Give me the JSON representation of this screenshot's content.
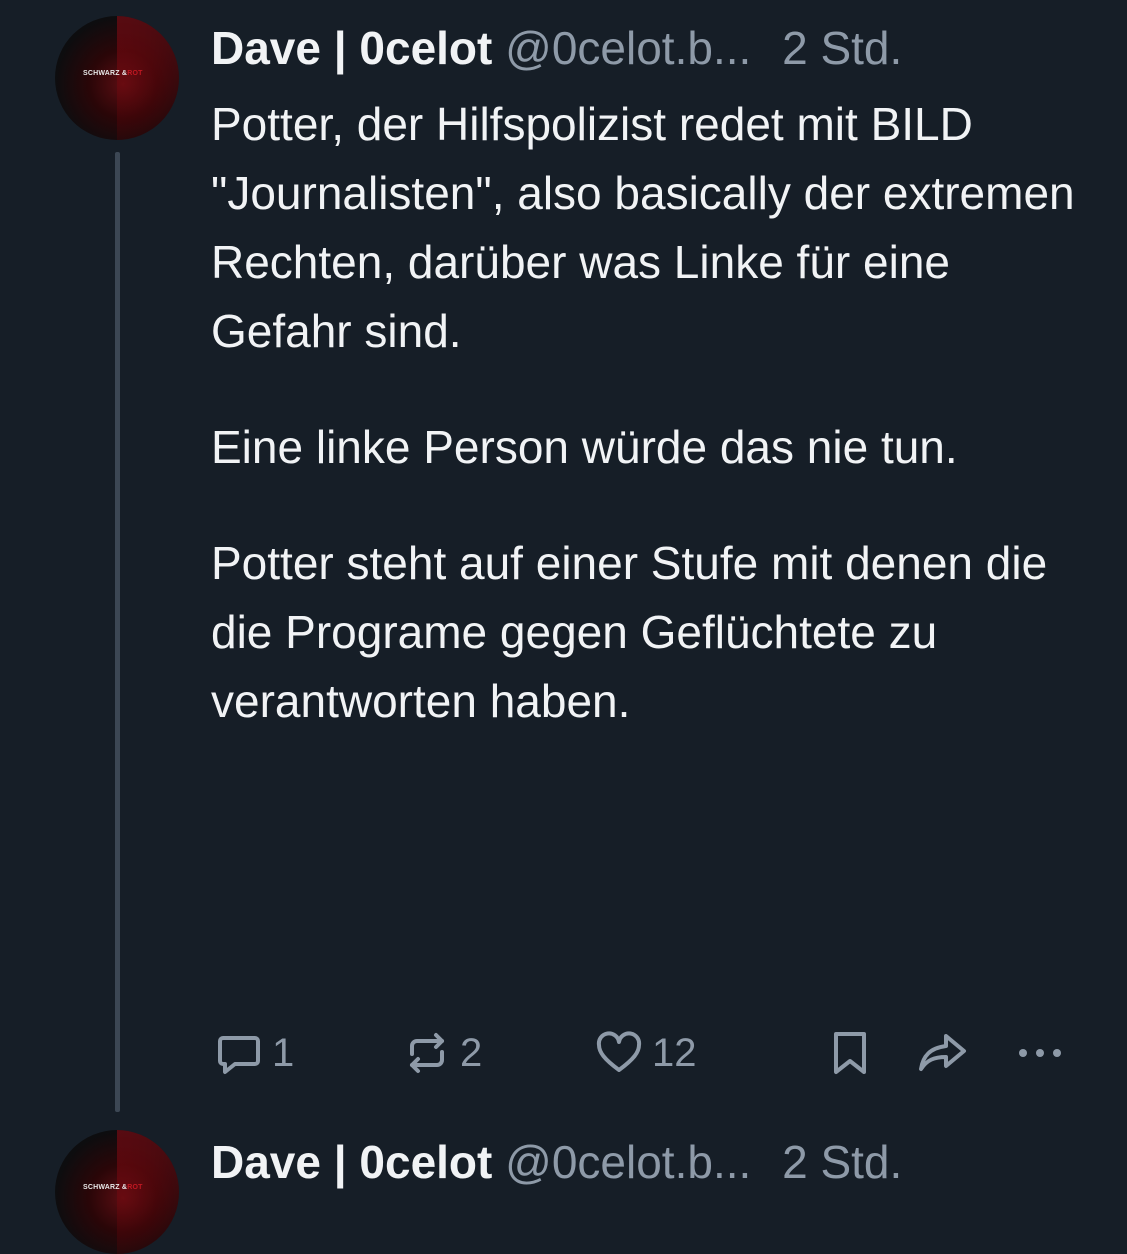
{
  "posts": [
    {
      "author": {
        "display_name": "Dave | 0celot",
        "handle": "@0celot.b...",
        "avatar_text_white": "SCHWARZ &",
        "avatar_text_red": "ROT"
      },
      "time": "2 Std.",
      "paragraphs": [
        "Potter, der Hilfspolizist redet mit BILD \"Journalisten\", also basically der extremen Rechten, darüber was Linke für eine Gefahr sind.",
        "Eine linke Person würde das nie tun.",
        "Potter steht auf einer Stufe mit denen die die Programe gegen Geflüchtete zu verantworten haben."
      ],
      "stats": {
        "replies": "1",
        "reposts": "2",
        "likes": "12"
      },
      "icons": [
        "reply-icon",
        "repost-icon",
        "like-icon",
        "bookmark-icon",
        "share-icon",
        "more-icon"
      ]
    },
    {
      "author": {
        "display_name": "Dave | 0celot",
        "handle": "@0celot.b...",
        "avatar_text_white": "SCHWARZ &",
        "avatar_text_red": "ROT"
      },
      "time": "2 Std."
    }
  ],
  "colors": {
    "background": "#161e27",
    "text": "#f1f3f5",
    "muted": "#8e9aa8",
    "thread_line": "#3c4754"
  }
}
